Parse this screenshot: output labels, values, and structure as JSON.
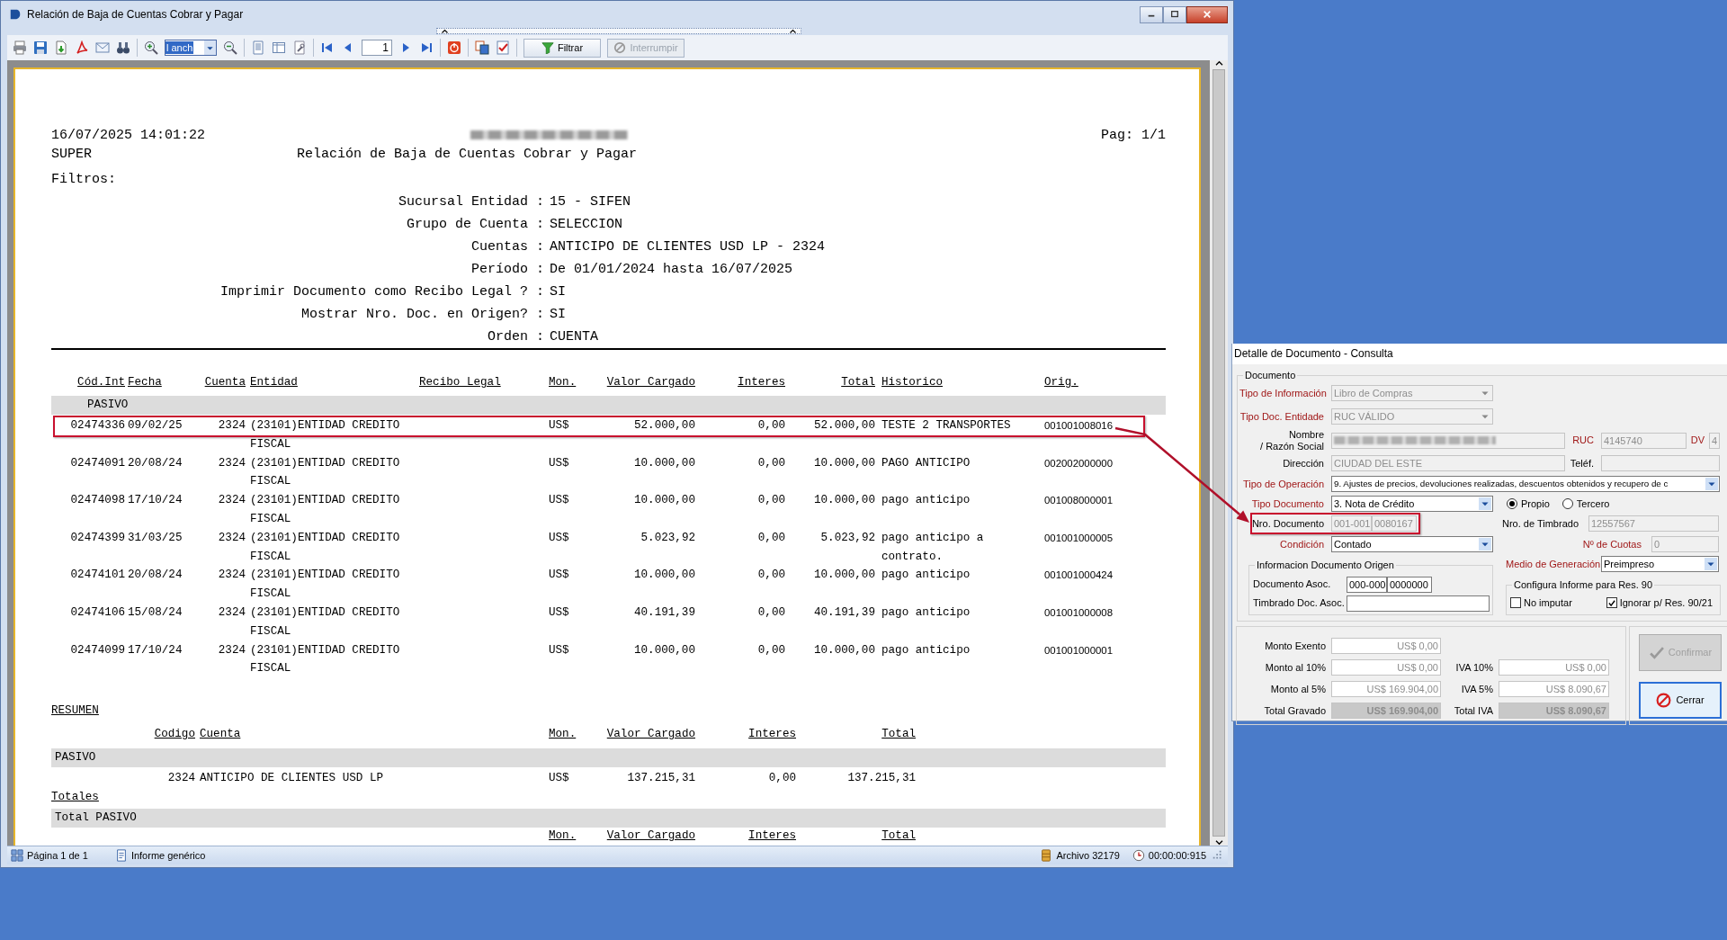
{
  "window": {
    "title": "Relación de Baja de Cuentas Cobrar y Pagar"
  },
  "toolbar": {
    "zoom_mode": "l anch",
    "page_number": "1",
    "buttons": [
      {
        "label": "Filtrar",
        "disabled": false
      },
      {
        "label": "Interrumpir",
        "disabled": true
      }
    ]
  },
  "report": {
    "datetime": "16/07/2025 14:01:22",
    "page": "Pag: 1/1",
    "user": "SUPER",
    "title": "Relación de Baja de Cuentas Cobrar y Pagar",
    "filters_label": "Filtros:",
    "filters": [
      {
        "label": "Sucursal Entidad :",
        "value": "15 - SIFEN"
      },
      {
        "label": "Grupo de Cuenta :",
        "value": "SELECCION"
      },
      {
        "label": "Cuentas :",
        "value": "ANTICIPO DE CLIENTES USD LP - 2324"
      },
      {
        "label": "Período :",
        "value": "De 01/01/2024 hasta 16/07/2025"
      },
      {
        "label": "Imprimir Documento como Recibo Legal ? :",
        "value": "SI"
      },
      {
        "label": "Mostrar Nro. Doc. en Origen? :",
        "value": "SI"
      },
      {
        "label": "Orden :",
        "value": "CUENTA"
      }
    ],
    "table": {
      "columns": [
        "Cód.Int",
        "Fecha",
        "Cuenta",
        "Entidad",
        "Recibo Legal",
        "Mon.",
        "Valor Cargado",
        "Interes",
        "Total",
        "Historico",
        "Orig."
      ],
      "group": "PASIVO",
      "rows": [
        {
          "cod_int": "02474336",
          "fecha": "09/02/25",
          "cuenta": "2324",
          "entidad": "(23101)ENTIDAD CREDITO FISCAL",
          "mon": "US$",
          "valor_cargado": "52.000,00",
          "interes": "0,00",
          "total": "52.000,00",
          "historico": "TESTE 2 TRANSPORTES",
          "orig": "001001008016",
          "highlighted": true
        },
        {
          "cod_int": "02474091",
          "fecha": "20/08/24",
          "cuenta": "2324",
          "entidad": "(23101)ENTIDAD CREDITO FISCAL",
          "mon": "US$",
          "valor_cargado": "10.000,00",
          "interes": "0,00",
          "total": "10.000,00",
          "historico": "PAGO ANTICIPO",
          "orig": "002002000000",
          "highlighted": false
        },
        {
          "cod_int": "02474098",
          "fecha": "17/10/24",
          "cuenta": "2324",
          "entidad": "(23101)ENTIDAD CREDITO FISCAL",
          "mon": "US$",
          "valor_cargado": "10.000,00",
          "interes": "0,00",
          "total": "10.000,00",
          "historico": "pago anticipo",
          "orig": "001008000001",
          "highlighted": false
        },
        {
          "cod_int": "02474399",
          "fecha": "31/03/25",
          "cuenta": "2324",
          "entidad": "(23101)ENTIDAD CREDITO FISCAL",
          "mon": "US$",
          "valor_cargado": "5.023,92",
          "interes": "0,00",
          "total": "5.023,92",
          "historico": "pago anticipo a contrato.",
          "orig": "001001000005",
          "highlighted": false
        },
        {
          "cod_int": "02474101",
          "fecha": "20/08/24",
          "cuenta": "2324",
          "entidad": "(23101)ENTIDAD CREDITO FISCAL",
          "mon": "US$",
          "valor_cargado": "10.000,00",
          "interes": "0,00",
          "total": "10.000,00",
          "historico": "pago anticipo",
          "orig": "001001000424",
          "highlighted": false
        },
        {
          "cod_int": "02474106",
          "fecha": "15/08/24",
          "cuenta": "2324",
          "entidad": "(23101)ENTIDAD CREDITO FISCAL",
          "mon": "US$",
          "valor_cargado": "40.191,39",
          "interes": "0,00",
          "total": "40.191,39",
          "historico": "pago anticipo",
          "orig": "001001000008",
          "highlighted": false
        },
        {
          "cod_int": "02474099",
          "fecha": "17/10/24",
          "cuenta": "2324",
          "entidad": "(23101)ENTIDAD CREDITO FISCAL",
          "mon": "US$",
          "valor_cargado": "10.000,00",
          "interes": "0,00",
          "total": "10.000,00",
          "historico": "pago anticipo",
          "orig": "001001000001",
          "highlighted": false
        }
      ]
    },
    "summary": {
      "title": "RESUMEN",
      "columns": [
        "Codigo",
        "Cuenta",
        "Mon.",
        "Valor Cargado",
        "Interes",
        "Total"
      ],
      "group": "PASIVO",
      "rows": [
        {
          "codigo": "2324",
          "cuenta": "ANTICIPO DE CLIENTES USD LP",
          "mon": "US$",
          "valor_cargado": "137.215,31",
          "interes": "0,00",
          "total": "137.215,31"
        }
      ],
      "totals_label": "Totales",
      "total_group": "Total PASIVO",
      "total_columns": [
        "Mon.",
        "Valor Cargado",
        "Interes",
        "Total"
      ]
    }
  },
  "status_bar": {
    "page": "Página 1 de 1",
    "report_type": "Informe genérico",
    "file": "Archivo 32179",
    "elapsed": "00:00:00:915"
  },
  "dialog": {
    "title": "Detalle de Documento - Consulta",
    "group_title": "Documento",
    "tipo_informacion": {
      "label": "Tipo de Información",
      "value": "Libro de Compras",
      "disabled": true,
      "required": true
    },
    "tipo_doc_entidad": {
      "label": "Tipo Doc. Entidade",
      "value": "RUC VÁLIDO",
      "disabled": true,
      "required": true
    },
    "nombre": {
      "label_lines": [
        "Nombre",
        "/ Razón Social"
      ],
      "disabled": true,
      "required": false
    },
    "ruc": {
      "label": "RUC",
      "value": "4145740",
      "disabled": true,
      "required": true
    },
    "dv": {
      "label": "DV",
      "value": "4",
      "disabled": true,
      "required": true
    },
    "direccion": {
      "label": "Dirección",
      "value": "CIUDAD DEL ESTE",
      "disabled": true,
      "required": false
    },
    "telefono": {
      "label": "Teléf.",
      "disabled": true,
      "required": false
    },
    "tipo_operacion": {
      "label": "Tipo de Operación",
      "value": "9. Ajustes de precios, devoluciones realizadas, descuentos obtenidos y recupero de c",
      "disabled": false,
      "required": true
    },
    "tipo_documento": {
      "label": "Tipo Documento",
      "value": "3. Nota de Crédito",
      "disabled": false,
      "required": true
    },
    "origen_radios": [
      {
        "label": "Propio",
        "selected": true
      },
      {
        "label": "Tercero",
        "selected": false
      }
    ],
    "nro_documento": {
      "label": "Nro. Documento",
      "prefix": "001-001",
      "number": "0080167",
      "disabled": true,
      "required": false,
      "highlighted": true
    },
    "nro_timbrado": {
      "label": "Nro. de Timbrado",
      "value": "12557567",
      "disabled": true,
      "required": false
    },
    "condicion": {
      "label": "Condición",
      "value": "Contado",
      "disabled": false,
      "required": true
    },
    "nro_cuotas": {
      "label": "Nº de Cuotas",
      "value": "0",
      "disabled": true,
      "required": true
    },
    "origen_group": {
      "title": "Informacion Documento Origen",
      "documento_asoc": {
        "label": "Documento Asoc.",
        "prefix": "000-000",
        "number": "0000000"
      },
      "timbrado_asoc": {
        "label": "Timbrado Doc. Asoc."
      }
    },
    "medio_generacion": {
      "label": "Medio de Generación",
      "value": "Preimpreso",
      "disabled": false,
      "required": true
    },
    "res90_group": {
      "title": "Configura Informe para Res. 90",
      "checks": [
        {
          "label": "No imputar",
          "checked": false
        },
        {
          "label": "Ignorar p/ Res. 90/21",
          "checked": true
        }
      ]
    },
    "totals": [
      {
        "kind": "amount",
        "label": "Monto Exento",
        "value": "US$ 0,00"
      },
      {
        "kind": "amount",
        "label": "Monto al 10%",
        "value": "US$ 0,00",
        "iva_label": "IVA 10%",
        "iva_value": "US$ 0,00"
      },
      {
        "kind": "amount",
        "label": "Monto al 5%",
        "value": "US$ 169.904,00",
        "iva_label": "IVA 5%",
        "iva_value": "US$ 8.090,67"
      },
      {
        "kind": "total",
        "label": "Total Gravado",
        "value": "US$ 169.904,00",
        "iva_label": "Total IVA",
        "iva_value": "US$ 8.090,67"
      }
    ],
    "buttons": [
      {
        "kind": "confirm",
        "label": "Confirmar",
        "disabled": true
      },
      {
        "kind": "close",
        "label": "Cerrar",
        "disabled": false
      }
    ]
  }
}
